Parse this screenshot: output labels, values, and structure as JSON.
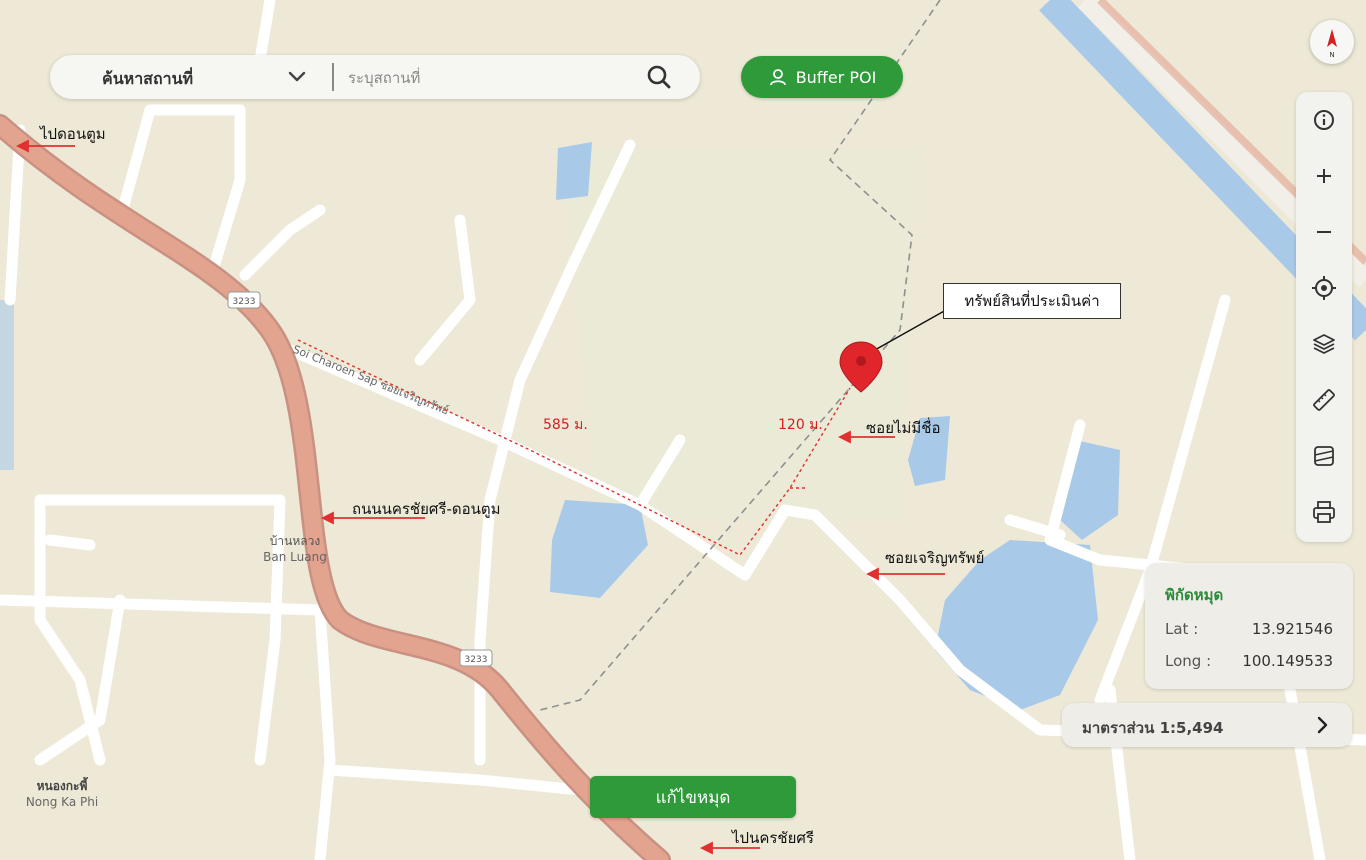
{
  "search": {
    "category": "ค้นหาสถานที่",
    "placeholder": "ระบุสถานที่"
  },
  "buffer_button": {
    "label": "Buffer POI"
  },
  "compass": {
    "letter": "N"
  },
  "toolbar": {
    "icons": [
      "info-icon",
      "zoom-in-icon",
      "zoom-out-icon",
      "locate-icon",
      "layers-icon",
      "ruler-icon",
      "map-style-icon",
      "print-icon"
    ]
  },
  "coordinates": {
    "title": "พิกัดหมุด",
    "lat_label": "Lat :",
    "lat": "13.921546",
    "long_label": "Long :",
    "long": "100.149533"
  },
  "scale": {
    "label": "มาตราส่วน 1:5,494"
  },
  "edit_button": {
    "label": "แก้ไขหมุด"
  },
  "annotations": {
    "to_don_tum": "ไปดอนตูม",
    "property": "ทรัพย์สินที่ประเมินค่า",
    "unnamed_soi": "ซอยไม่มีชื่อ",
    "main_road": "ถนนนครชัยศรี-ดอนตูม",
    "soi_charoen_sap": "ซอยเจริญทรัพย์",
    "to_nakhon_chai_si": "ไปนครชัยศรี",
    "distance_main": "585 ม.",
    "distance_soi": "120 ม."
  },
  "map_labels": {
    "ban_luang_th": "บ้านหลวง",
    "ban_luang_en": "Ban Luang",
    "nong_ka_phi_th": "หนองกะพี้",
    "nong_ka_phi_en": "Nong Ka Phi",
    "route_shield": "3233",
    "soi_charoen_sap_map": "Soi Charoen Sap ซอยเจริญทรัพย์"
  },
  "colors": {
    "map_bg": "#ede9d6",
    "main_road": "#e2a38f",
    "water": "#a9c9e8",
    "accent_green": "#2e9a3a",
    "annotation_red": "#d42020",
    "pin_red": "#e0262b"
  }
}
